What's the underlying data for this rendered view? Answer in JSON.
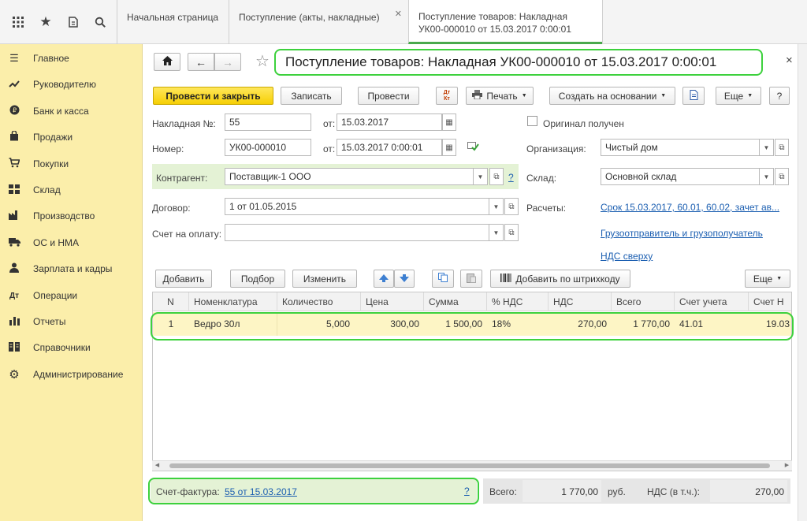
{
  "topbar": {
    "icons": [
      "apps-grid-icon",
      "star-icon",
      "history-icon",
      "search-icon"
    ],
    "tabs": [
      {
        "label": "Начальная страница"
      },
      {
        "label": "Поступление (акты, накладные)"
      },
      {
        "label": "Поступление товаров: Накладная УК00-000010 от 15.03.2017 0:00:01"
      }
    ]
  },
  "sidebar": {
    "items": [
      {
        "label": "Главное",
        "icon": "menu-icon"
      },
      {
        "label": "Руководителю",
        "icon": "trend-icon"
      },
      {
        "label": "Банк и касса",
        "icon": "ruble-coin-icon"
      },
      {
        "label": "Продажи",
        "icon": "bag-icon"
      },
      {
        "label": "Покупки",
        "icon": "cart-icon"
      },
      {
        "label": "Склад",
        "icon": "warehouse-icon"
      },
      {
        "label": "Производство",
        "icon": "factory-icon"
      },
      {
        "label": "ОС и НМА",
        "icon": "truck-icon"
      },
      {
        "label": "Зарплата и кадры",
        "icon": "person-icon"
      },
      {
        "label": "Операции",
        "icon": "operations-icon"
      },
      {
        "label": "Отчеты",
        "icon": "report-chart-icon"
      },
      {
        "label": "Справочники",
        "icon": "book-icon"
      },
      {
        "label": "Администрирование",
        "icon": "gear-icon"
      }
    ]
  },
  "form": {
    "title": "Поступление товаров: Накладная УК00-000010 от 15.03.2017 0:00:01",
    "toolbar": {
      "post_close": "Провести и закрыть",
      "save": "Записать",
      "post": "Провести",
      "dt_kt": "Дт Кт",
      "print": "Печать",
      "create_basis": "Создать на основании",
      "more": "Еще",
      "help": "?"
    },
    "fields": {
      "invoice_no_label": "Накладная №:",
      "invoice_no": "55",
      "from1_label": "от:",
      "from1": "15.03.2017",
      "number_label": "Номер:",
      "number": "УК00-000010",
      "from2_label": "от:",
      "from2": "15.03.2017  0:00:01",
      "original_label": "Оригинал получен",
      "org_label": "Организация:",
      "org": "Чистый дом",
      "contractor_label": "Контрагент:",
      "contractor": "Поставщик-1 ООО",
      "warehouse_label": "Склад:",
      "warehouse": "Основной склад",
      "contract_label": "Договор:",
      "contract": "1 от 01.05.2015",
      "settlements_label": "Расчеты:",
      "settlements_link": "Срок 15.03.2017, 60.01, 60.02, зачет ав...",
      "payment_account_label": "Счет на оплату:",
      "payment_account": "",
      "shipper_link": "Грузоотправитель и грузополучатель",
      "vat_link": "НДС сверху",
      "help_q": "?"
    },
    "table_toolbar": {
      "add": "Добавить",
      "pick": "Подбор",
      "edit": "Изменить",
      "barcode": "Добавить по штрихкоду",
      "more": "Еще"
    },
    "table": {
      "columns": [
        "N",
        "Номенклатура",
        "Количество",
        "Цена",
        "Сумма",
        "% НДС",
        "НДС",
        "Всего",
        "Счет учета",
        "Счет Н"
      ],
      "rows": [
        {
          "n": "1",
          "item": "Ведро 30л",
          "qty": "5,000",
          "price": "300,00",
          "sum": "1 500,00",
          "vat_rate": "18%",
          "vat": "270,00",
          "total": "1 770,00",
          "account": "41.01",
          "account_vat": "19.03"
        }
      ]
    },
    "footer": {
      "invoice_label": "Счет-фактура:",
      "invoice_link": "55 от 15.03.2017",
      "help_q": "?",
      "total_label": "Всего:",
      "total": "1 770,00",
      "currency": "руб.",
      "vat_label": "НДС (в т.ч.):",
      "vat": "270,00"
    }
  }
}
